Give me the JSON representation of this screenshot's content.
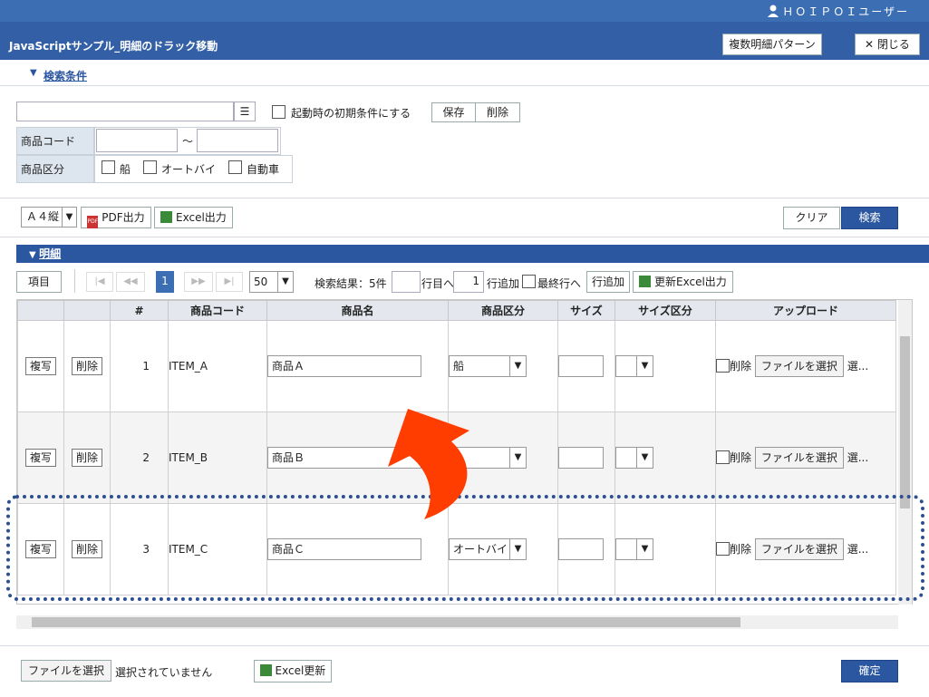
{
  "header": {
    "user": "ＨＯＩＰＯＩユーザー",
    "title": "JavaScriptサンプル_明細のドラック移動",
    "multi_pattern": "複数明細パターン",
    "close": "閉じる"
  },
  "search": {
    "section": "検索条件",
    "init_cond": "起動時の初期条件にする",
    "save": "保存",
    "delete": "削除",
    "code_label": "商品コード",
    "tilde": "～",
    "kbn_label": "商品区分",
    "opt1": "船",
    "opt2": "オートバイ",
    "opt3": "自動車"
  },
  "toolbar": {
    "paper": "Ａ４縦",
    "pdf": "PDF出力",
    "excel": "Excel出力",
    "clear": "クリア",
    "search": "検索"
  },
  "detail": {
    "section": "明細",
    "item_btn": "項目",
    "page": "1",
    "page_size": "50",
    "result": "検索結果：5件",
    "goto_suffix": "行目へ",
    "add_count": "1",
    "add_row": "行追加",
    "last_row": "最終行へ",
    "add_row_btn": "行追加",
    "update_excel": "更新Excel出力"
  },
  "columns": [
    "",
    "",
    "#",
    "商品コード",
    "商品名",
    "商品区分",
    "サイズ",
    "サイズ区分",
    "アップロード"
  ],
  "rows": [
    {
      "copy": "複写",
      "del": "削除",
      "no": "1",
      "code": "ITEM_A",
      "name": "商品Ａ",
      "kbn": "船",
      "del_chk": "削除",
      "file": "ファイルを選択",
      "trail": "選..."
    },
    {
      "copy": "複写",
      "del": "削除",
      "no": "2",
      "code": "ITEM_B",
      "name": "商品Ｂ",
      "kbn": "",
      "del_chk": "削除",
      "file": "ファイルを選択",
      "trail": "選..."
    },
    {
      "copy": "複写",
      "del": "削除",
      "no": "3",
      "code": "ITEM_C",
      "name": "商品Ｃ",
      "kbn": "オートバイ",
      "del_chk": "削除",
      "file": "ファイルを選択",
      "trail": "選..."
    }
  ],
  "footer": {
    "file": "ファイルを選択",
    "no_file": "選択されていません",
    "excel_update": "Excel更新",
    "confirm": "確定"
  },
  "colors": {
    "accent": "#2b56a0",
    "arrow": "#ff3d00",
    "dotted": "#2b4f8f"
  }
}
